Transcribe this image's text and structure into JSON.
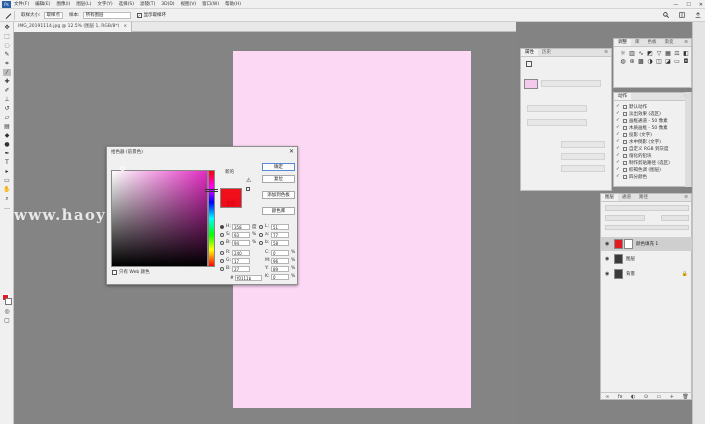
{
  "menu": {
    "logo": "Ps",
    "items": [
      "文件(F)",
      "编辑(E)",
      "图像(I)",
      "图层(L)",
      "文字(Y)",
      "选择(S)",
      "滤镜(T)",
      "3D(D)",
      "视图(V)",
      "窗口(W)",
      "帮助(H)"
    ],
    "win_min": "—",
    "win_max": "☐",
    "win_close": "✕"
  },
  "options": {
    "sample_size_label": "取样大小:",
    "sample_size_value": "取样点",
    "sample_label": "样本:",
    "sample_value": "所有图层",
    "ring_checkbox": "显示取样环"
  },
  "document": {
    "tab_title": "IMG_20191114.jpg @ 12.5% (图层 1, RGB/8*)",
    "tab_close": "×"
  },
  "watermark": "www.haoyidianshe",
  "picker": {
    "title": "拾色器 (前景色)",
    "new_label": "新的",
    "current_label": "当前",
    "ok": "确定",
    "cancel": "复位",
    "add_swatch": "添加到色板",
    "libraries": "颜色库",
    "only_web": "只有 Web 颜色",
    "hsb": [
      {
        "key": "H:",
        "value": "358",
        "unit": "度"
      },
      {
        "key": "S:",
        "value": "93",
        "unit": "%"
      },
      {
        "key": "B:",
        "value": "94",
        "unit": "%"
      }
    ],
    "rgb": [
      {
        "key": "R:",
        "value": "240",
        "unit": ""
      },
      {
        "key": "G:",
        "value": "17",
        "unit": ""
      },
      {
        "key": "B:",
        "value": "27",
        "unit": ""
      }
    ],
    "lab": [
      {
        "key": "L:",
        "value": "51",
        "unit": ""
      },
      {
        "key": "a:",
        "value": "77",
        "unit": ""
      },
      {
        "key": "b:",
        "value": "58",
        "unit": ""
      }
    ],
    "cmyk": [
      {
        "key": "C:",
        "value": "0",
        "unit": "%"
      },
      {
        "key": "M:",
        "value": "96",
        "unit": "%"
      },
      {
        "key": "Y:",
        "value": "89",
        "unit": "%"
      },
      {
        "key": "K:",
        "value": "0",
        "unit": "%"
      }
    ],
    "hex_label": "#",
    "hex_value": "f0111b",
    "new_color": "#f10f1b",
    "current_color": "#ef0c1d"
  },
  "history_panel": {
    "tabs": [
      "属性",
      "历史"
    ],
    "menu_icon": "≡",
    "rows": [
      "",
      "",
      "",
      "",
      "",
      ""
    ]
  },
  "adjust_panel": {
    "tabs": [
      "调整",
      "库",
      "色板",
      "渐变"
    ],
    "menu_icon": "≡"
  },
  "actions_panel": {
    "tabs": [
      "动作"
    ],
    "menu_icon": "≡",
    "items": [
      "默认动作",
      "淡出效果 (选区)",
      "画框通道 - 50 像素",
      "木质画框 - 50 像素",
      "投影 (文字)",
      "水中倒影 (文字)",
      "自定义 RGB 到灰度",
      "熔化的铅块",
      "制作剪贴路径 (选区)",
      "棕褐色调 (图层)",
      "四分颜色"
    ]
  },
  "layers_panel": {
    "tabs": [
      "图层",
      "通道",
      "路径"
    ],
    "menu_icon": "≡",
    "layers": [
      {
        "name": "颜色填充 1",
        "selected": true
      },
      {
        "name": "图层",
        "selected": false
      },
      {
        "name": "背景",
        "selected": false
      }
    ],
    "lock_icon": "🔒",
    "bottom_icons": [
      "∞",
      "fx",
      "◐",
      "⊙",
      "▭",
      "+",
      "🗑"
    ]
  }
}
